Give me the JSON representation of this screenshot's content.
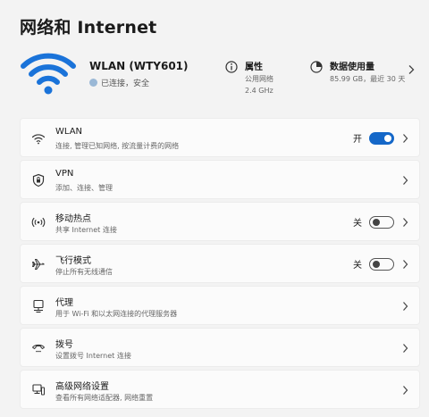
{
  "page": {
    "title": "网络和 Internet"
  },
  "header": {
    "network_name": "WLAN (WTY601)",
    "status": "已连接，安全",
    "properties": {
      "title": "属性",
      "line1": "公用网络",
      "line2": "2.4 GHz"
    },
    "data_usage": {
      "title": "数据使用量",
      "line1": "85.99 GB，最近 30 天"
    }
  },
  "settings": [
    {
      "id": "wlan",
      "icon": "wifi-icon",
      "title": "WLAN",
      "subtitle": "连接, 管理已知网络, 按流量计费的网络",
      "toggle": {
        "label": "开",
        "state": "on"
      }
    },
    {
      "id": "vpn",
      "icon": "shield-icon",
      "title": "VPN",
      "subtitle": "添加、连接、管理"
    },
    {
      "id": "hotspot",
      "icon": "hotspot-icon",
      "title": "移动热点",
      "subtitle": "共享 Internet 连接",
      "toggle": {
        "label": "关",
        "state": "off"
      }
    },
    {
      "id": "airplane",
      "icon": "airplane-icon",
      "title": "飞行模式",
      "subtitle": "停止所有无线通信",
      "toggle": {
        "label": "关",
        "state": "off"
      }
    },
    {
      "id": "proxy",
      "icon": "proxy-icon",
      "title": "代理",
      "subtitle": "用于 Wi-Fi 和以太网连接的代理服务器"
    },
    {
      "id": "dialup",
      "icon": "dialup-icon",
      "title": "拨号",
      "subtitle": "设置拨号 Internet 连接"
    },
    {
      "id": "advanced",
      "icon": "computer-icon",
      "title": "高级网络设置",
      "subtitle": "查看所有网络适配器, 网络重置"
    }
  ],
  "colors": {
    "accent": "#1467c8",
    "wifi_blue": "#1a73d9",
    "background": "#f3f3f3",
    "card": "#fbfbfb"
  }
}
